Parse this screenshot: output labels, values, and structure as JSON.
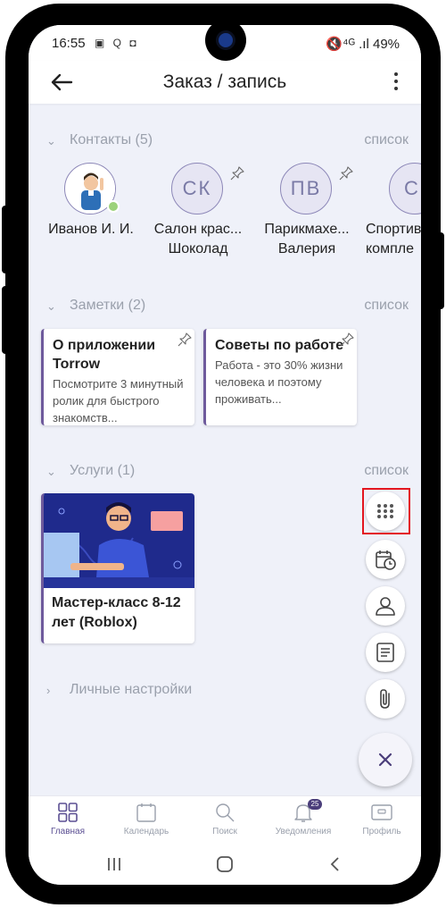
{
  "status_bar": {
    "time": "16:55",
    "left_icons": "▣ Q ◘",
    "right": "🔇⁴ᴳ .ıl 49%"
  },
  "app_bar": {
    "title": "Заказ / запись",
    "back_icon": "arrow-left-icon",
    "menu_icon": "more-vertical-icon"
  },
  "contacts": {
    "header": "Контакты (5)",
    "link": "список",
    "items": [
      {
        "name": "Иванов И. И.",
        "initials": "",
        "has_photo": true,
        "online": true,
        "pinned": false
      },
      {
        "name": "Салон крас...\nШоколад",
        "initials": "СК",
        "pinned": true
      },
      {
        "name": "Парикмахе...\nВалерия",
        "initials": "ПВ",
        "pinned": true
      },
      {
        "name": "Спортив\nкомпле",
        "initials": "С",
        "pinned": false
      }
    ]
  },
  "notes": {
    "header": "Заметки (2)",
    "link": "список",
    "items": [
      {
        "title": "О приложении Torrow",
        "body": "Посмотрите 3 минутный ролик для быстрого знакомств...",
        "pinned": true
      },
      {
        "title": "Советы по работе",
        "body": "Работа - это 30% жизни человека и поэтому проживать...",
        "pinned": true
      }
    ]
  },
  "services": {
    "header": "Услуги (1)",
    "link": "список",
    "items": [
      {
        "title": "Мастер-класс 8-12 лет (Roblox)"
      }
    ]
  },
  "personal_settings": {
    "header": "Личные настройки"
  },
  "fab_menu": {
    "items": [
      "grid-dots-icon",
      "calendar-clock-icon",
      "user-icon",
      "note-icon",
      "paperclip-icon"
    ],
    "close_icon": "close-icon",
    "highlighted": "grid-dots-icon"
  },
  "bottom_nav": {
    "items": [
      {
        "label": "Главная",
        "icon": "home-grid-icon",
        "active": true
      },
      {
        "label": "Календарь",
        "icon": "calendar-icon",
        "active": false
      },
      {
        "label": "Поиск",
        "icon": "search-icon",
        "active": false
      },
      {
        "label": "Уведомления",
        "icon": "bell-icon",
        "active": false,
        "badge": "25"
      },
      {
        "label": "Профиль",
        "icon": "profile-card-icon",
        "active": false
      }
    ]
  },
  "system_nav": [
    "recents-icon",
    "home-icon",
    "back-icon"
  ],
  "colors": {
    "accent": "#5b4f93",
    "background": "#eff1f9",
    "muted_text": "#9aa0ac",
    "highlight_box": "#e3161f"
  }
}
